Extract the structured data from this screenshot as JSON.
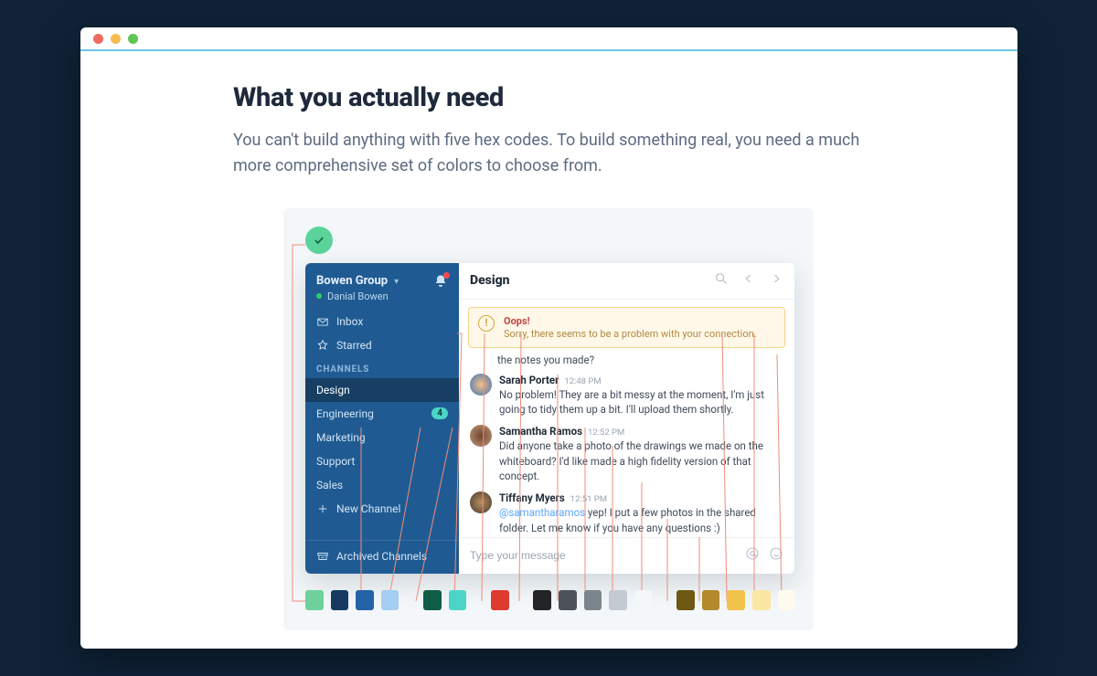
{
  "heading": "What you actually need",
  "lead": "You can't build anything with five hex codes. To build something real, you need a much more comprehensive set of colors to choose from.",
  "workspace": {
    "name": "Bowen Group",
    "user": "Danial Bowen"
  },
  "sidebar": {
    "inbox": "Inbox",
    "starred": "Starred",
    "channels_heading": "CHANNELS",
    "channels": {
      "design": "Design",
      "engineering": "Engineering",
      "engineering_badge": "4",
      "marketing": "Marketing",
      "support": "Support",
      "sales": "Sales"
    },
    "new_channel": "New Channel",
    "archived": "Archived Channels"
  },
  "channel_title": "Design",
  "alert": {
    "title": "Oops!",
    "message": "Sorry, there seems to be a problem with your connection."
  },
  "messages": {
    "frag": "the notes you made?",
    "m1": {
      "name": "Sarah Porter",
      "time": "12:48 PM",
      "text": "No problem! They are a bit messy at the moment, I'm just going to tidy them up a bit. I'll upload them shortly."
    },
    "m2": {
      "name": "Samantha Ramos",
      "time": "12:52 PM",
      "text": "Did anyone take a photo of the drawings we made on the whiteboard? I'd like made a high fidelity version of that concept."
    },
    "m3": {
      "name": "Tiffany Myers",
      "time": "12:51 PM",
      "mention": "@samantharamos",
      "text": " yep! I put a few photos in the shared folder. Let me know if you have any questions :)"
    }
  },
  "composer_placeholder": "Type your message",
  "swatches": {
    "c01": "#6ed19b",
    "c02": "#173a63",
    "c03": "#2563a8",
    "c04": "#a6cdf3",
    "c05": "#0f5c47",
    "c06": "#4cd5c7",
    "c07": "#dd3a32",
    "c08": "#222426",
    "c09": "#4c5259",
    "c10": "#7c848c",
    "c11": "#c4cad1",
    "c12": "#f4f7f9",
    "c13": "#6e5813",
    "c14": "#b3892d",
    "c15": "#f2c34a",
    "c16": "#fbe6a2",
    "c17": "#fffaef"
  }
}
